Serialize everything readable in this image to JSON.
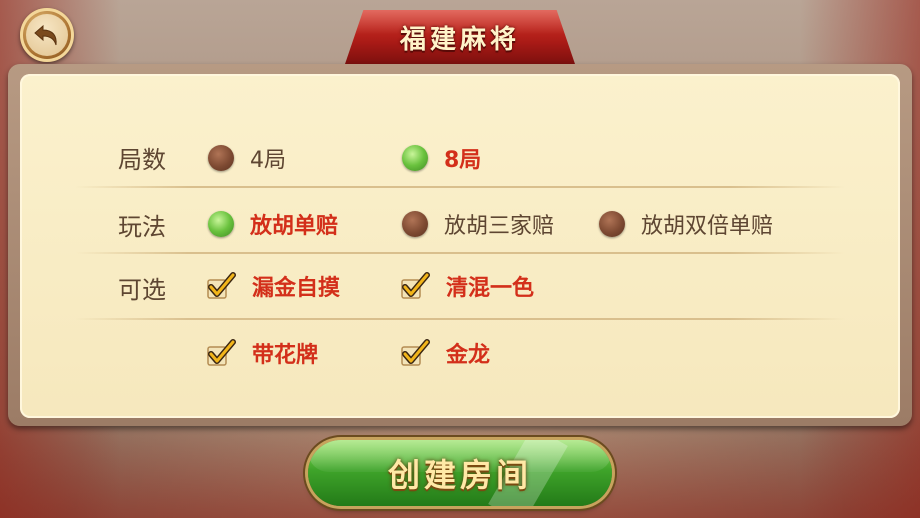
{
  "header": {
    "title": "福建麻将"
  },
  "rows": {
    "rounds": {
      "label": "局数",
      "options": [
        {
          "label": "4局",
          "selected": false
        },
        {
          "label": "8局",
          "selected": true
        }
      ]
    },
    "play_mode": {
      "label": "玩法",
      "options": [
        {
          "label": "放胡单赔",
          "selected": true
        },
        {
          "label": "放胡三家赔",
          "selected": false
        },
        {
          "label": "放胡双倍单赔",
          "selected": false
        }
      ]
    },
    "optional": {
      "label": "可选",
      "options": [
        {
          "label": "漏金自摸",
          "checked": true
        },
        {
          "label": "清混一色",
          "checked": true
        },
        {
          "label": "带花牌",
          "checked": true
        },
        {
          "label": "金龙",
          "checked": true
        }
      ]
    }
  },
  "footer": {
    "create_label": "创建房间"
  },
  "icons": {
    "back": "back-arrow-icon",
    "radio_on": "radio-selected-icon",
    "radio_off": "radio-unselected-icon",
    "check": "checkmark-icon"
  },
  "colors": {
    "selected_text": "#d32f1a",
    "unselected_text": "#5e4632",
    "title_tab": "#a91a16",
    "create_button": "#3fa42a",
    "panel": "#f6e8bd"
  }
}
